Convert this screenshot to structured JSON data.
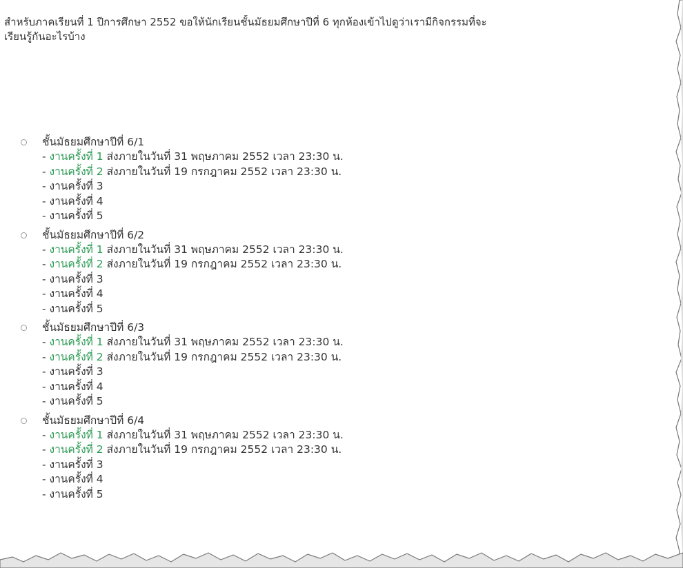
{
  "intro": {
    "line1": "สำหรับภาคเรียนที่ 1 ปีการศึกษา 2552 ขอให้นักเรียนชั้นมัธยมศึกษาปีที่ 6 ทุกห้องเข้าไปดูว่าเรามีกิจกรรมที่จะ",
    "line2": "เรียนรู้กันอะไรบ้าง"
  },
  "colors": {
    "text": "#333333",
    "link": "#2a9a52",
    "bullet": "#999999"
  },
  "classes": [
    {
      "title": "ชั้นมัธยมศึกษาปีที่ 6/1",
      "assignments": [
        {
          "dash": "- ",
          "link": "งานครั้งที่ 1",
          "detail": " ส่งภายในวันที่ 31 พฤษภาคม 2552 เวลา 23:30 น."
        },
        {
          "dash": "- ",
          "link": "งานครั้งที่ 2",
          "detail": " ส่งภายในวันที่ 19 กรกฎาคม 2552 เวลา 23:30 น."
        },
        {
          "dash": "- ",
          "text": "งานครั้งที่ 3"
        },
        {
          "dash": "- ",
          "text": "งานครั้งที่ 4"
        },
        {
          "dash": "- ",
          "text": "งานครั้งที่ 5"
        }
      ]
    },
    {
      "title": "ชั้นมัธยมศึกษาปีที่ 6/2",
      "assignments": [
        {
          "dash": "- ",
          "link": "งานครั้งที่ 1",
          "detail": " ส่งภายในวันที่ 31 พฤษภาคม 2552 เวลา 23:30 น."
        },
        {
          "dash": "- ",
          "link": "งานครั้งที่ 2",
          "detail": " ส่งภายในวันที่ 19 กรกฎาคม 2552 เวลา 23:30 น."
        },
        {
          "dash": "- ",
          "text": "งานครั้งที่ 3"
        },
        {
          "dash": "- ",
          "text": "งานครั้งที่ 4"
        },
        {
          "dash": "- ",
          "text": "งานครั้งที่ 5"
        }
      ]
    },
    {
      "title": "ชั้นมัธยมศึกษาปีที่ 6/3",
      "assignments": [
        {
          "dash": "- ",
          "link": "งานครั้งที่ 1",
          "detail": " ส่งภายในวันที่ 31 พฤษภาคม 2552 เวลา 23:30 น."
        },
        {
          "dash": "- ",
          "link": "งานครั้งที่ 2",
          "detail": " ส่งภายในวันที่ 19 กรกฎาคม 2552 เวลา 23:30 น."
        },
        {
          "dash": "- ",
          "text": "งานครั้งที่ 3"
        },
        {
          "dash": "- ",
          "text": "งานครั้งที่ 4"
        },
        {
          "dash": "- ",
          "text": "งานครั้งที่ 5"
        }
      ]
    },
    {
      "title": "ชั้นมัธยมศึกษาปีที่ 6/4",
      "assignments": [
        {
          "dash": "- ",
          "link": "งานครั้งที่ 1",
          "detail": " ส่งภายในวันที่ 31 พฤษภาคม 2552 เวลา 23:30 น."
        },
        {
          "dash": "- ",
          "link": "งานครั้งที่ 2",
          "detail": " ส่งภายในวันที่ 19 กรกฎาคม 2552 เวลา 23:30 น."
        },
        {
          "dash": "- ",
          "text": "งานครั้งที่ 3"
        },
        {
          "dash": "- ",
          "text": "งานครั้งที่ 4"
        },
        {
          "dash": "- ",
          "text": "งานครั้งที่ 5"
        }
      ]
    }
  ]
}
